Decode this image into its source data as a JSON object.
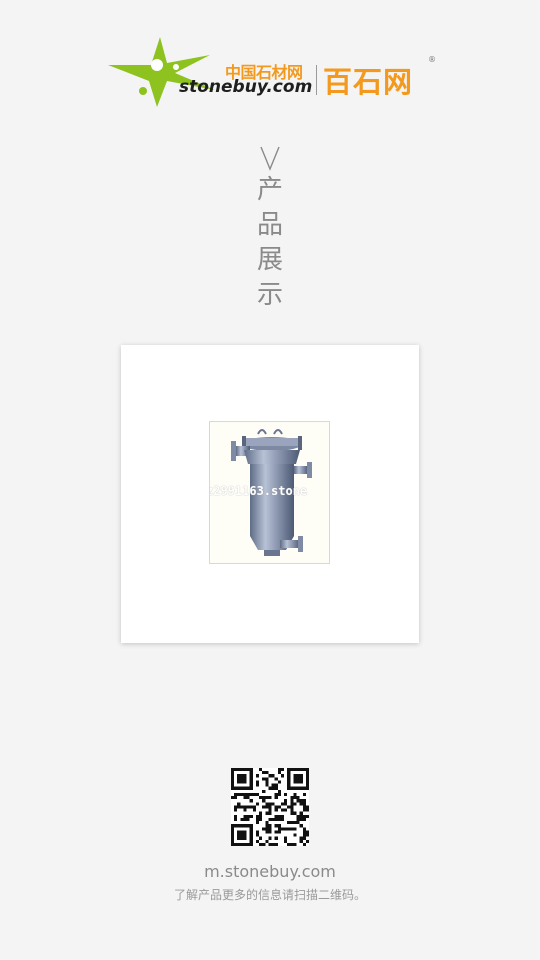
{
  "brand": {
    "cn_small": "中国石材网",
    "domain": "stonebuy.com",
    "cn_big": "百石网",
    "reg_mark": "®",
    "green": "#8dc21f",
    "orange": "#f39a1e"
  },
  "section": {
    "mark_icon": "v-chevron-icon",
    "chars": [
      "产",
      "品",
      "展",
      "示"
    ]
  },
  "product": {
    "image_icon": "filter-housing-image",
    "watermark": "z2991163.stone"
  },
  "footer": {
    "qr_icon": "qr-code",
    "site": "m.stonebuy.com",
    "hint": "了解产品更多的信息请扫描二维码。"
  }
}
